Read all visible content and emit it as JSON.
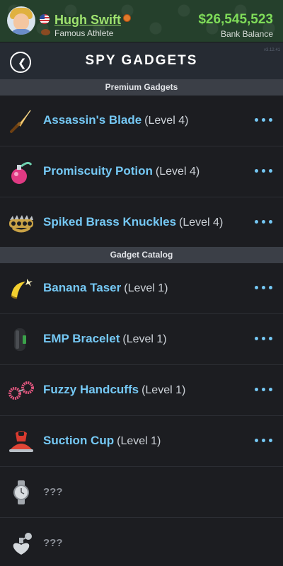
{
  "header": {
    "player_name": "Hugh Swift",
    "player_role": "Famous Athlete",
    "bank_amount": "$26,545,523",
    "bank_label": "Bank Balance",
    "flag_icon": "us-flag-icon",
    "badge_icon": "basketball-icon"
  },
  "titlebar": {
    "title": "SPY GADGETS",
    "back_icon": "chevron-left-icon",
    "version": "v3.12.41"
  },
  "sections": [
    {
      "label": "Premium Gadgets",
      "items": [
        {
          "name": "Assassin's Blade",
          "level": "(Level 4)",
          "icon": "dagger-icon"
        },
        {
          "name": "Promiscuity Potion",
          "level": "(Level 4)",
          "icon": "potion-icon"
        },
        {
          "name": "Spiked Brass Knuckles",
          "level": "(Level 4)",
          "icon": "brass-knuckles-icon"
        }
      ]
    },
    {
      "label": "Gadget Catalog",
      "items": [
        {
          "name": "Banana Taser",
          "level": "(Level 1)",
          "icon": "banana-icon"
        },
        {
          "name": "EMP Bracelet",
          "level": "(Level 1)",
          "icon": "bracelet-icon"
        },
        {
          "name": "Fuzzy Handcuffs",
          "level": "(Level 1)",
          "icon": "handcuffs-icon"
        },
        {
          "name": "Suction Cup",
          "level": "(Level 1)",
          "icon": "suction-cup-icon"
        },
        {
          "name": "???",
          "icon": "wristwatch-icon"
        },
        {
          "name": "???",
          "icon": "perfume-bottle-icon"
        }
      ]
    }
  ],
  "colors": {
    "accent_blue": "#75c8f4",
    "money_green": "#7fdc59",
    "name_green": "#9fe36f"
  }
}
